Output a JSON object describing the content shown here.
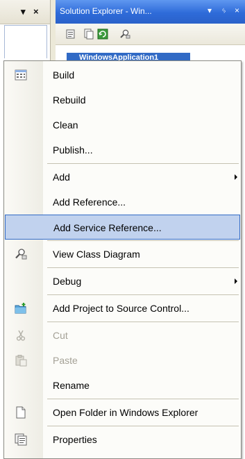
{
  "left_pane": {
    "header_glyphs": [
      "▾",
      "×"
    ]
  },
  "solution_explorer": {
    "title": "Solution Explorer - Win...",
    "title_glyphs": [
      "▾",
      "ᛃ",
      "×"
    ],
    "toolbar_icons": [
      "properties-icon",
      "show-all-files-icon",
      "refresh-icon",
      "view-class-diagram-icon"
    ],
    "tree_node": "WindowsApplication1"
  },
  "context_menu": {
    "items": [
      {
        "label": "Build",
        "icon": "build-icon",
        "enabled": true,
        "submenu": false,
        "highlighted": false
      },
      {
        "label": "Rebuild",
        "icon": "",
        "enabled": true,
        "submenu": false,
        "highlighted": false
      },
      {
        "label": "Clean",
        "icon": "",
        "enabled": true,
        "submenu": false,
        "highlighted": false
      },
      {
        "label": "Publish...",
        "icon": "",
        "enabled": true,
        "submenu": false,
        "highlighted": false
      },
      {
        "label": "Add",
        "icon": "",
        "enabled": true,
        "submenu": true,
        "highlighted": false
      },
      {
        "label": "Add Reference...",
        "icon": "",
        "enabled": true,
        "submenu": false,
        "highlighted": false
      },
      {
        "label": "Add Service Reference...",
        "icon": "",
        "enabled": true,
        "submenu": false,
        "highlighted": true
      },
      {
        "label": "View Class Diagram",
        "icon": "class-diagram-icon",
        "enabled": true,
        "submenu": false,
        "highlighted": false
      },
      {
        "label": "Debug",
        "icon": "",
        "enabled": true,
        "submenu": true,
        "highlighted": false
      },
      {
        "label": "Add Project to Source Control...",
        "icon": "source-control-icon",
        "enabled": true,
        "submenu": false,
        "highlighted": false
      },
      {
        "label": "Cut",
        "icon": "scissors-icon",
        "enabled": false,
        "submenu": false,
        "highlighted": false
      },
      {
        "label": "Paste",
        "icon": "paste-icon",
        "enabled": false,
        "submenu": false,
        "highlighted": false
      },
      {
        "label": "Rename",
        "icon": "",
        "enabled": true,
        "submenu": false,
        "highlighted": false
      },
      {
        "label": "Open Folder in Windows Explorer",
        "icon": "open-folder-icon",
        "enabled": true,
        "submenu": false,
        "highlighted": false
      },
      {
        "label": "Properties",
        "icon": "properties-icon",
        "enabled": true,
        "submenu": false,
        "highlighted": false
      }
    ]
  },
  "colors": {
    "highlight_fill": "#c1d2ee",
    "highlight_border": "#316ac5",
    "title_bar": "#2e6bd9",
    "disabled_text": "#a4a196"
  }
}
